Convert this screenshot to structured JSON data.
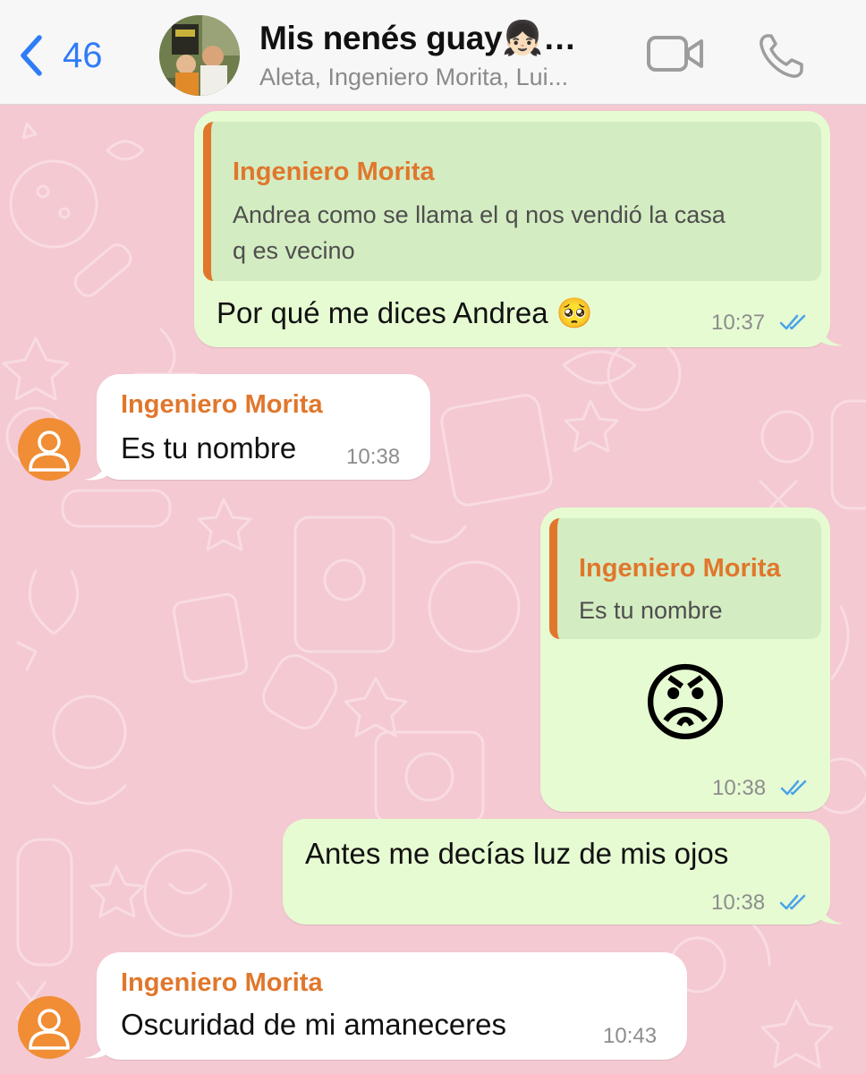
{
  "header": {
    "back_count": "46",
    "title": "Mis nenés guay👧🏻…",
    "subtitle": "Aleta, Ingeniero Morita, Lui..."
  },
  "messages": [
    {
      "direction": "out",
      "quote_author": "Ingeniero Morita",
      "quote_line1": "Andrea como se llama el q nos vendió la casa",
      "quote_line2": "q es vecino",
      "text": "Por qué me dices Andrea 🥺",
      "time": "10:37",
      "status": "read"
    },
    {
      "direction": "in",
      "sender": "Ingeniero Morita",
      "text": "Es tu nombre",
      "time": "10:38"
    },
    {
      "direction": "out",
      "quote_author": "Ingeniero Morita",
      "quote_line1": "Es tu nombre",
      "emoji": "😡",
      "time": "10:38",
      "status": "read"
    },
    {
      "direction": "out",
      "text": "Antes me decías luz de mis ojos",
      "time": "10:38",
      "status": "read"
    },
    {
      "direction": "in",
      "sender": "Ingeniero Morita",
      "text": "Oscuridad de mi amaneceres",
      "time": "10:43"
    }
  ],
  "colors": {
    "accent_blue": "#2f7cf6",
    "sender_orange": "#e0772c",
    "wallpaper_pink": "#f4c9d2",
    "outgoing_bubble": "#e6fbd2",
    "incoming_bubble": "#ffffff",
    "read_ticks": "#4aa3ea"
  },
  "icons": [
    "back-chevron-icon",
    "video-call-icon",
    "phone-call-icon",
    "double-check-icon",
    "default-avatar-icon"
  ]
}
